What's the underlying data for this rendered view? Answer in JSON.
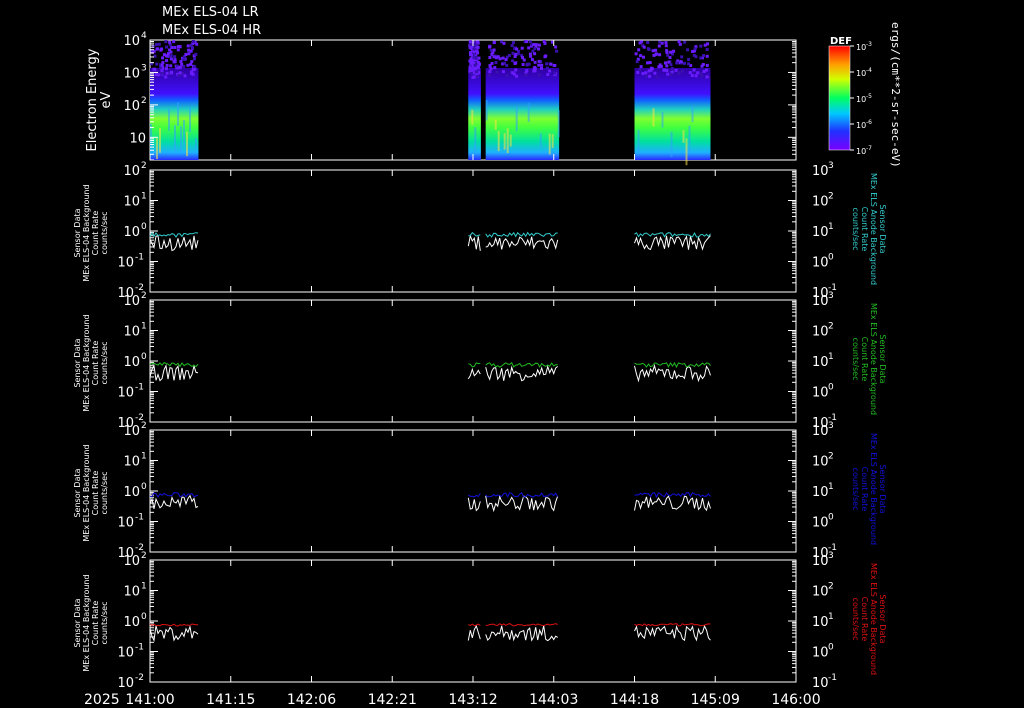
{
  "titles": [
    "MEx ELS-04 LR",
    "MEx ELS-04 HR"
  ],
  "colors": {
    "background": "#000000",
    "axes": "#ffffff",
    "white_trace": "#ffffff",
    "cyan": "#33cccc",
    "green": "#22bb22",
    "blue": "#1111dd",
    "red": "#dd1111"
  },
  "spectrogram": {
    "ylabel": [
      "Electron Energy",
      "eV"
    ],
    "ytick_labels": [
      "10",
      "10",
      "10",
      "10"
    ],
    "ytick_exps": [
      "",
      "2",
      "3",
      "4"
    ],
    "colorbar": {
      "label": "DEF",
      "unit": "ergs/(cm**2-sr-sec-eV)",
      "tick_exps": [
        "-3",
        "-4",
        "-5",
        "-6",
        "-7"
      ]
    }
  },
  "panels": [
    {
      "left_label": [
        "Sensor Data",
        "MEx ELS-04 Background",
        "Count Rate",
        "counts/sec"
      ],
      "right_label": [
        "Sensor Data",
        "MEx ELS Anode Background",
        "Count Rate",
        "counts/sec"
      ],
      "right_color": "#33cccc"
    },
    {
      "left_label": [
        "Sensor Data",
        "MEx ELS-04 Background",
        "Count Rate",
        "counts/sec"
      ],
      "right_label": [
        "Sensor Data",
        "MEx ELS Anode Background",
        "Count Rate",
        "counts/sec"
      ],
      "right_color": "#22bb22"
    },
    {
      "left_label": [
        "Sensor Data",
        "MEx ELS-04 Background",
        "Count Rate",
        "counts/sec"
      ],
      "right_label": [
        "Sensor Data",
        "MEx ELS Anode Background",
        "Count Rate",
        "counts/sec"
      ],
      "right_color": "#1111dd"
    },
    {
      "left_label": [
        "Sensor Data",
        "MEx ELS-04 Background",
        "Count Rate",
        "counts/sec"
      ],
      "right_label": [
        "Sensor Data",
        "MEx ELS Anode Background",
        "Count Rate",
        "counts/sec"
      ],
      "right_color": "#dd1111"
    }
  ],
  "x_axis": {
    "year": "2025",
    "tick_labels": [
      "141:00",
      "141:15",
      "142:06",
      "142:21",
      "143:12",
      "144:03",
      "144:18",
      "145:09",
      "146:00"
    ]
  },
  "chart_data": {
    "type": "line",
    "x_ticks": [
      "141:00",
      "141:15",
      "142:06",
      "142:21",
      "143:12",
      "144:03",
      "144:18",
      "145:09",
      "146:00"
    ],
    "data_intervals": [
      [
        "141:00",
        "141:09"
      ],
      [
        "143:09",
        "143:17"
      ],
      [
        "143:20",
        "144:04"
      ],
      [
        "144:18",
        "145:06"
      ]
    ],
    "spectrogram": {
      "ylabel": "Electron Energy eV",
      "yscale": "log",
      "ylim": [
        2,
        10000
      ],
      "colorbar_range": [
        1e-07,
        0.001
      ],
      "colorbar_label": "DEF"
    },
    "count_panels": {
      "left_yscale": "log",
      "left_ylim": [
        0.01,
        100
      ],
      "right_yscale": "log",
      "right_ylim": [
        0.1,
        1000
      ],
      "left_ytick_exps": [
        "2",
        "1",
        "0",
        "-1",
        "-2"
      ],
      "right_ytick_exps": [
        "3",
        "2",
        "1",
        "0",
        "-1"
      ],
      "white_series_level": 0.4,
      "colored_series_level": 0.75
    }
  }
}
